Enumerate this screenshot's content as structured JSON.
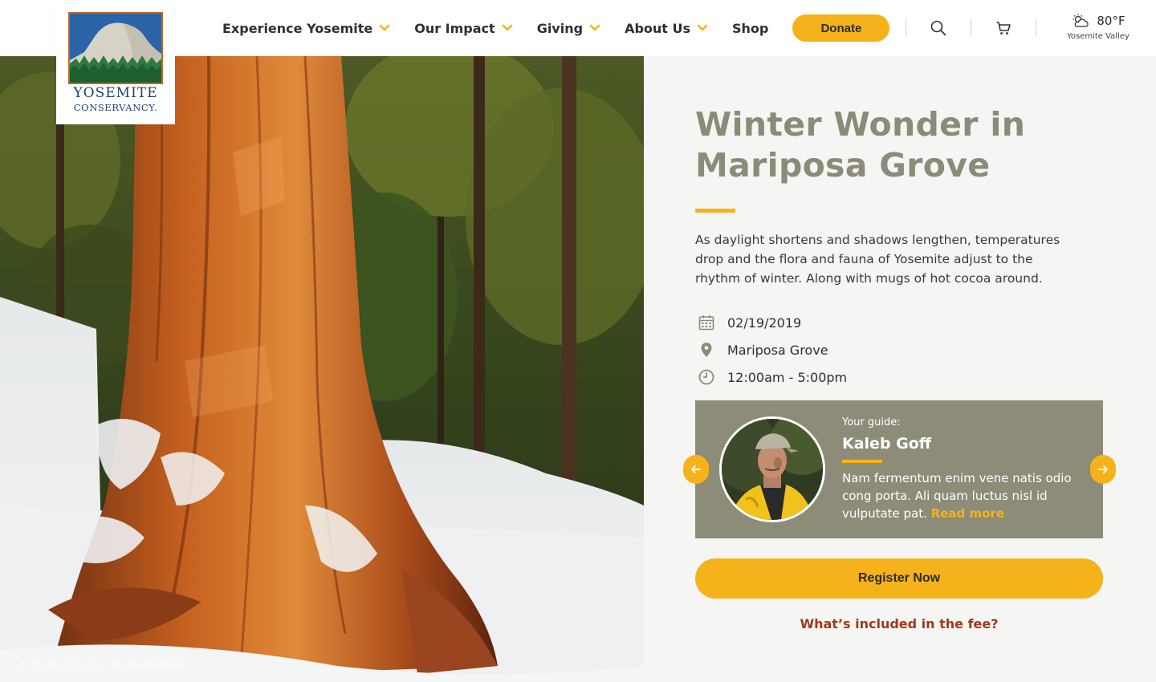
{
  "header": {
    "logo": {
      "line1": "YOSEMITE",
      "line2": "CONSERVANCY."
    },
    "nav": [
      {
        "label": "Experience Yosemite",
        "dropdown": true
      },
      {
        "label": "Our Impact",
        "dropdown": true
      },
      {
        "label": "Giving",
        "dropdown": true
      },
      {
        "label": "About Us",
        "dropdown": true
      },
      {
        "label": "Shop",
        "dropdown": false
      }
    ],
    "donate_label": "Donate",
    "icons": {
      "search": "search-icon",
      "cart": "cart-icon",
      "weather": "partly-cloudy-icon"
    },
    "weather": {
      "temp": "80°F",
      "location": "Yosemite Valley"
    }
  },
  "hero": {
    "caption_text": "The title of the photo",
    "caption_author": "by Lilia Geschenk"
  },
  "event": {
    "title": "Winter Wonder in Mariposa Grove",
    "description": "As daylight shortens and shadows lengthen, temperatures drop and the flora and fauna of Yosemite adjust to the rhythm of winter. Along with mugs of hot cocoa around.",
    "date": "02/19/2019",
    "location": "Mariposa Grove",
    "time": "12:00am - 5:00pm"
  },
  "guide": {
    "label": "Your guide:",
    "name": "Kaleb Goff",
    "bio": "Nam fermentum enim vene natis odio cong porta. Ali quam luctus nisl id vulputate pat.",
    "read_more": "Read more"
  },
  "actions": {
    "register_label": "Register Now",
    "fee_link": "What’s included in the fee?"
  },
  "colors": {
    "accent": "#f6b21b",
    "title_gray": "#8c8b78",
    "guide_bg": "#8d8c79",
    "link_red": "#a2381b"
  }
}
